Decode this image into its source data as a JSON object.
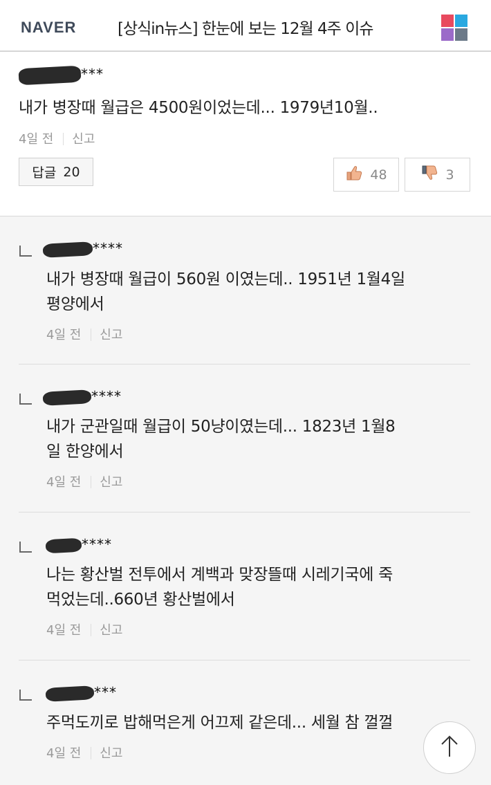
{
  "header": {
    "logo": "NAVER",
    "title": "[상식in뉴스] 한눈에 보는 12월 4주 이슈",
    "app_icon": "app-grid-icon",
    "app_colors": [
      "#e84a5f",
      "#2aa8e0",
      "#9b6bc9",
      "#6c7a89"
    ]
  },
  "main_comment": {
    "user_suffix": "***",
    "text": "내가 병장때 월급은 4500원이었는데... 1979년10월..",
    "time": "4일 전",
    "report": "신고",
    "reply_label": "답글",
    "reply_count": "20",
    "likes": "48",
    "dislikes": "3"
  },
  "replies": [
    {
      "user_suffix": "****",
      "line1": "내가 병장때 월급이 560원 이였는데.. 1951년 1월4일",
      "line2": "평양에서",
      "time": "4일 전",
      "report": "신고"
    },
    {
      "user_suffix": "****",
      "line1": "내가 군관일때 월급이 50냥이였는데... 1823년 1월8",
      "line2": "일 한양에서",
      "time": "4일 전",
      "report": "신고"
    },
    {
      "user_suffix": "****",
      "line1": "나는 황산벌 전투에서 계백과 맞장뜰때 시레기국에 죽",
      "line2": "먹었는데..660년 황산벌에서",
      "time": "4일 전",
      "report": "신고"
    },
    {
      "user_suffix": "***",
      "line1": "주먹도끼로 밥해먹은게 어끄제 같은데... 세월 참 껄껄",
      "line2": "",
      "time": "4일 전",
      "report": "신고"
    }
  ],
  "colors": {
    "replies_bg": "#f5f5f5",
    "meta": "#999999"
  }
}
